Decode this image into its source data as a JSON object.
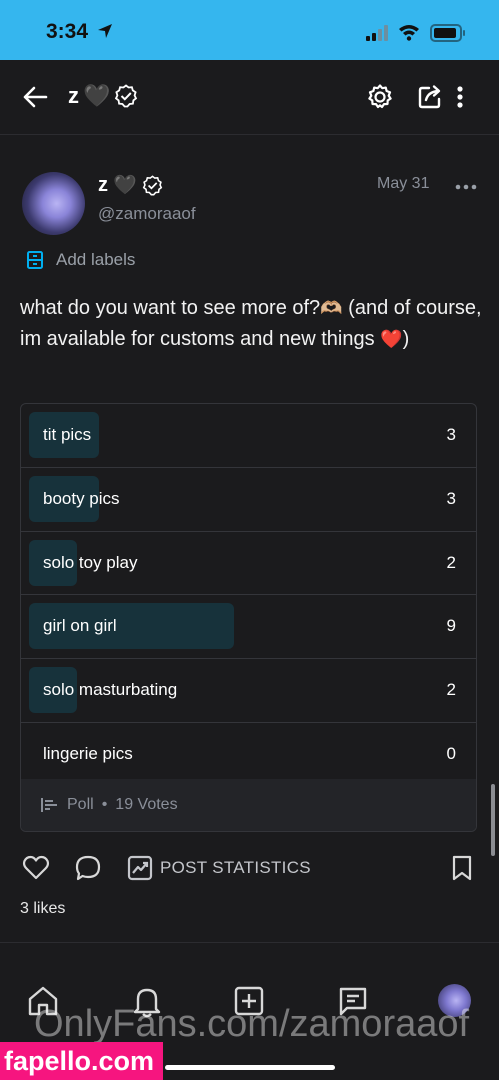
{
  "status_bar": {
    "time": "3:34"
  },
  "header": {
    "title": "z",
    "title_emoji": "🖤"
  },
  "post": {
    "author_name": "z",
    "author_emoji": "🖤",
    "author_handle": "@zamoraaof",
    "date": "May 31",
    "add_labels": "Add labels",
    "text_part1": "what do you want to see more of?",
    "text_emoji1": "🫶🏼",
    "text_part2": " (and of course, im available for customs and new things ",
    "text_emoji2": "❤️",
    "text_part3": ")"
  },
  "poll": {
    "options": [
      {
        "label": "tit pics",
        "count": "3",
        "fraction": 0.16
      },
      {
        "label": "booty pics",
        "count": "3",
        "fraction": 0.16
      },
      {
        "label": "solo toy play",
        "count": "2",
        "fraction": 0.105
      },
      {
        "label": "girl on girl",
        "count": "9",
        "fraction": 0.47
      },
      {
        "label": "solo masturbating",
        "count": "2",
        "fraction": 0.105
      },
      {
        "label": "lingerie pics",
        "count": "0",
        "fraction": 0
      }
    ],
    "footer_label": "Poll",
    "footer_sep": "•",
    "votes": "19 Votes"
  },
  "actions": {
    "stats_label": "POST STATISTICS",
    "likes": "3 likes"
  },
  "watermark": "OnlyFans.com/zamoraaof",
  "site_badge": "fapello.com",
  "colors": {
    "status_bar": "#35b6ee",
    "background": "#1b1b1d",
    "poll_bar": "#17323b",
    "accent": "#00aff0",
    "badge": "#f6157f"
  }
}
